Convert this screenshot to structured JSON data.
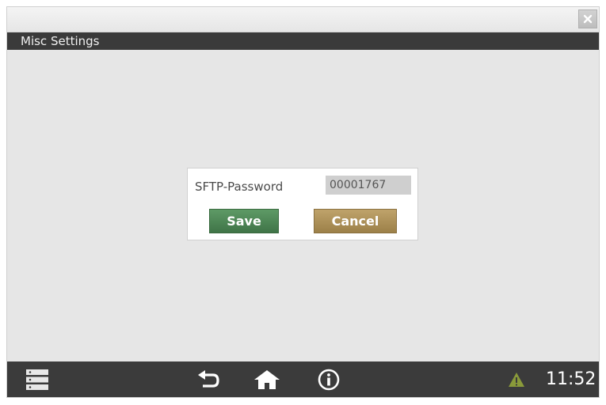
{
  "window": {
    "title": "Misc Settings"
  },
  "dialog": {
    "field_label": "SFTP-Password",
    "field_value": "00001767",
    "save_label": "Save",
    "cancel_label": "Cancel"
  },
  "statusbar": {
    "time": "11:52"
  },
  "colors": {
    "save_button": "#4a8352",
    "cancel_button": "#ad8f58",
    "titlebar": "#3a3a3a",
    "warning_icon": "#8a9a3a"
  },
  "icons": [
    "close-icon",
    "menu-icon",
    "back-icon",
    "home-icon",
    "info-icon",
    "warning-icon"
  ]
}
